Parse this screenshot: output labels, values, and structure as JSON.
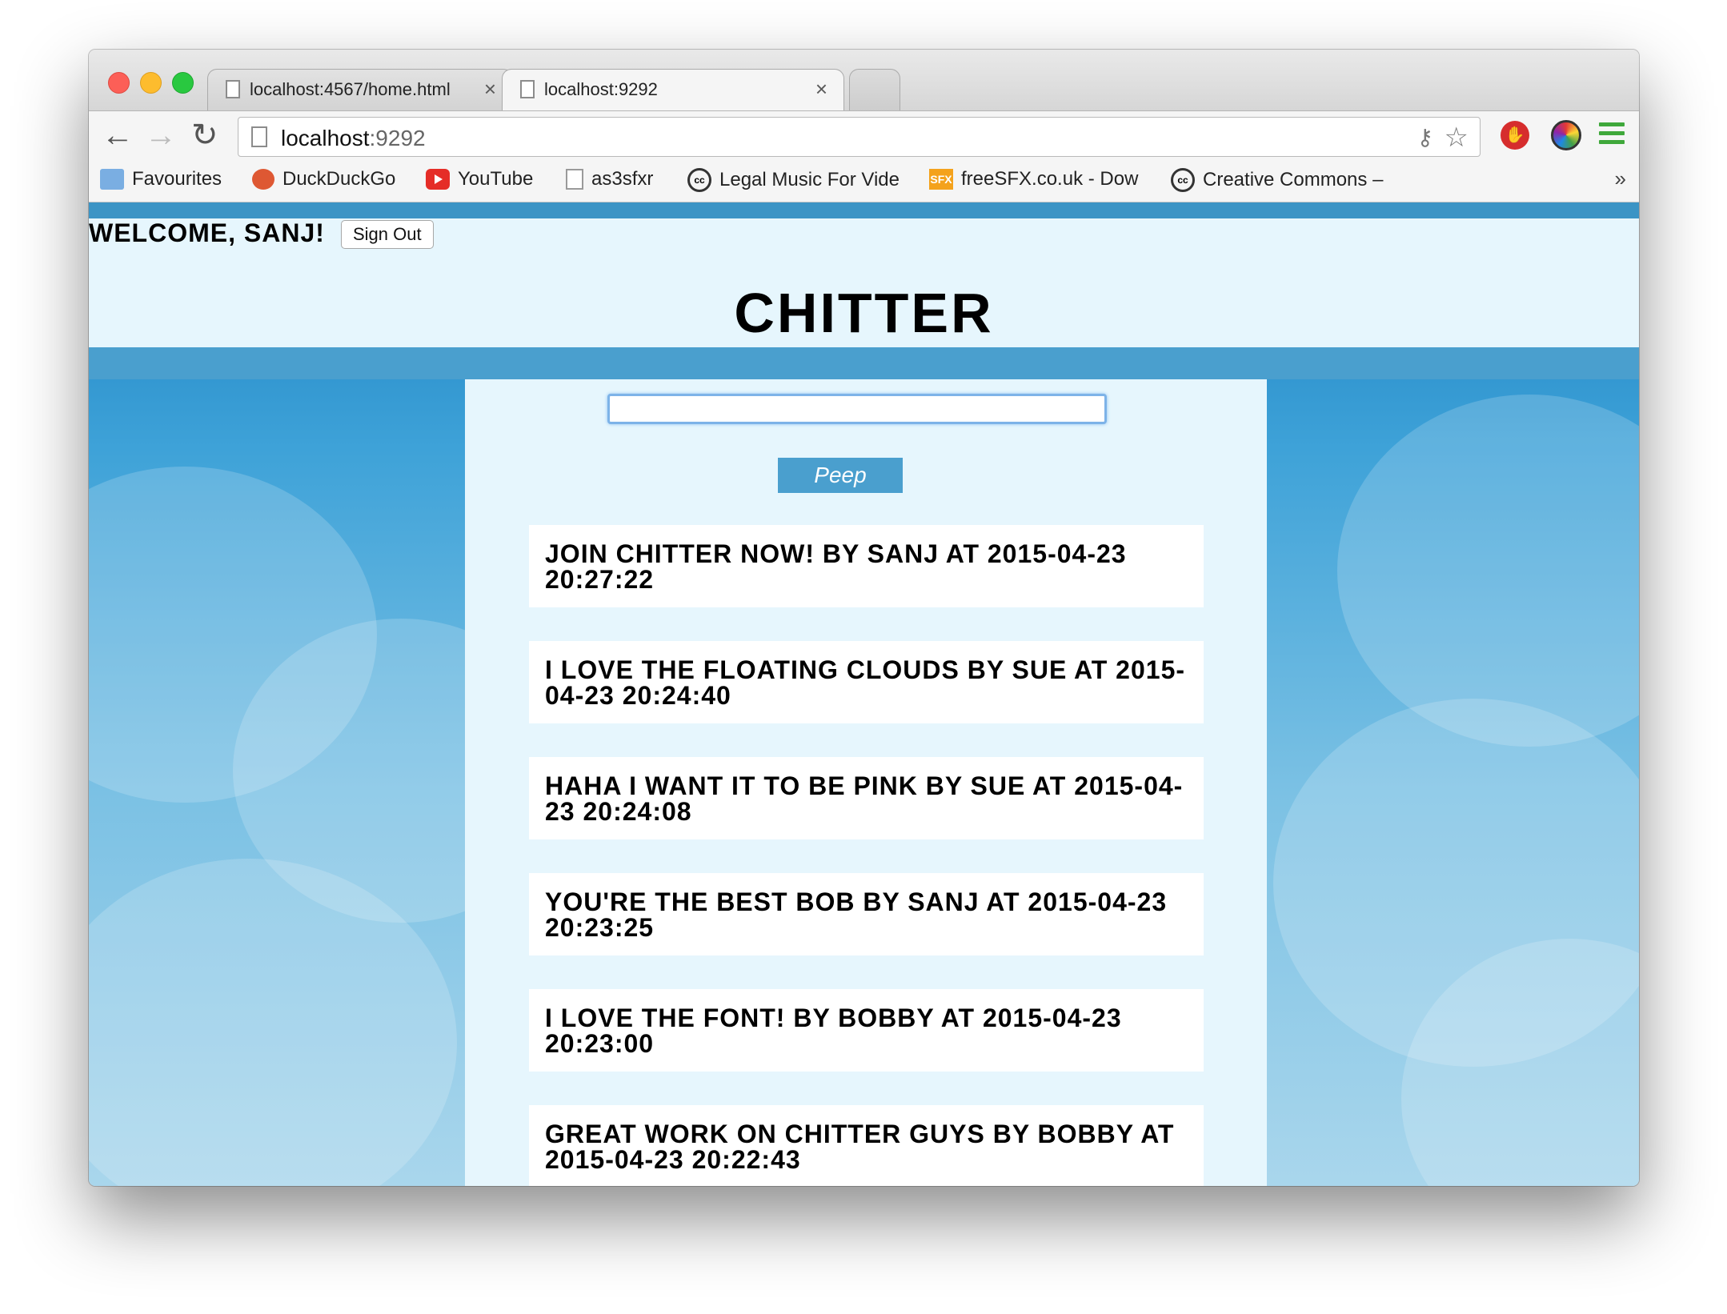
{
  "tabs": [
    {
      "title": "localhost:4567/home.html",
      "close": "×"
    },
    {
      "title": "localhost:9292",
      "close": "×"
    }
  ],
  "toolbar": {
    "back": "←",
    "forward": "→",
    "reload": "↻",
    "url_host": "localhost",
    "url_port": ":9292",
    "key": "⚷",
    "star": "☆",
    "stop_ext": "✋"
  },
  "bookmarks": {
    "items": [
      {
        "label": "Favourites",
        "icon": "folder-icon"
      },
      {
        "label": "DuckDuckGo",
        "icon": "duckduckgo-icon"
      },
      {
        "label": "YouTube",
        "icon": "youtube-icon"
      },
      {
        "label": "as3sfxr",
        "icon": "document-icon"
      },
      {
        "label": "Legal Music For Vide",
        "icon": "creative-commons-icon"
      },
      {
        "label": "freeSFX.co.uk - Dow",
        "icon": "freesfx-icon"
      },
      {
        "label": "Creative Commons –",
        "icon": "creative-commons-icon"
      }
    ],
    "more": "»",
    "cc_glyph": "cc",
    "sfx_glyph": "SFX"
  },
  "page": {
    "welcome": "WELCOME, SANJ!",
    "signout_label": "Sign Out",
    "title": "CHITTER",
    "peep_input_value": "",
    "peep_button_label": "Peep",
    "peeps": [
      "JOIN CHITTER NOW! BY SANJ AT 2015-04-23 20:27:22",
      "I LOVE THE FLOATING CLOUDS BY SUE AT 2015-04-23 20:24:40",
      "HAHA I WANT IT TO BE PINK BY SUE AT 2015-04-23 20:24:08",
      "YOU'RE THE BEST BOB BY SANJ AT 2015-04-23 20:23:25",
      "I LOVE THE FONT! BY BOBBY AT 2015-04-23 20:23:00",
      "GREAT WORK ON CHITTER GUYS BY BOBBY AT 2015-04-23 20:22:43"
    ]
  },
  "colors": {
    "accent_blue": "#4a9fce",
    "header_bg": "#e6f6fd",
    "peep_bg": "#ffffff"
  }
}
